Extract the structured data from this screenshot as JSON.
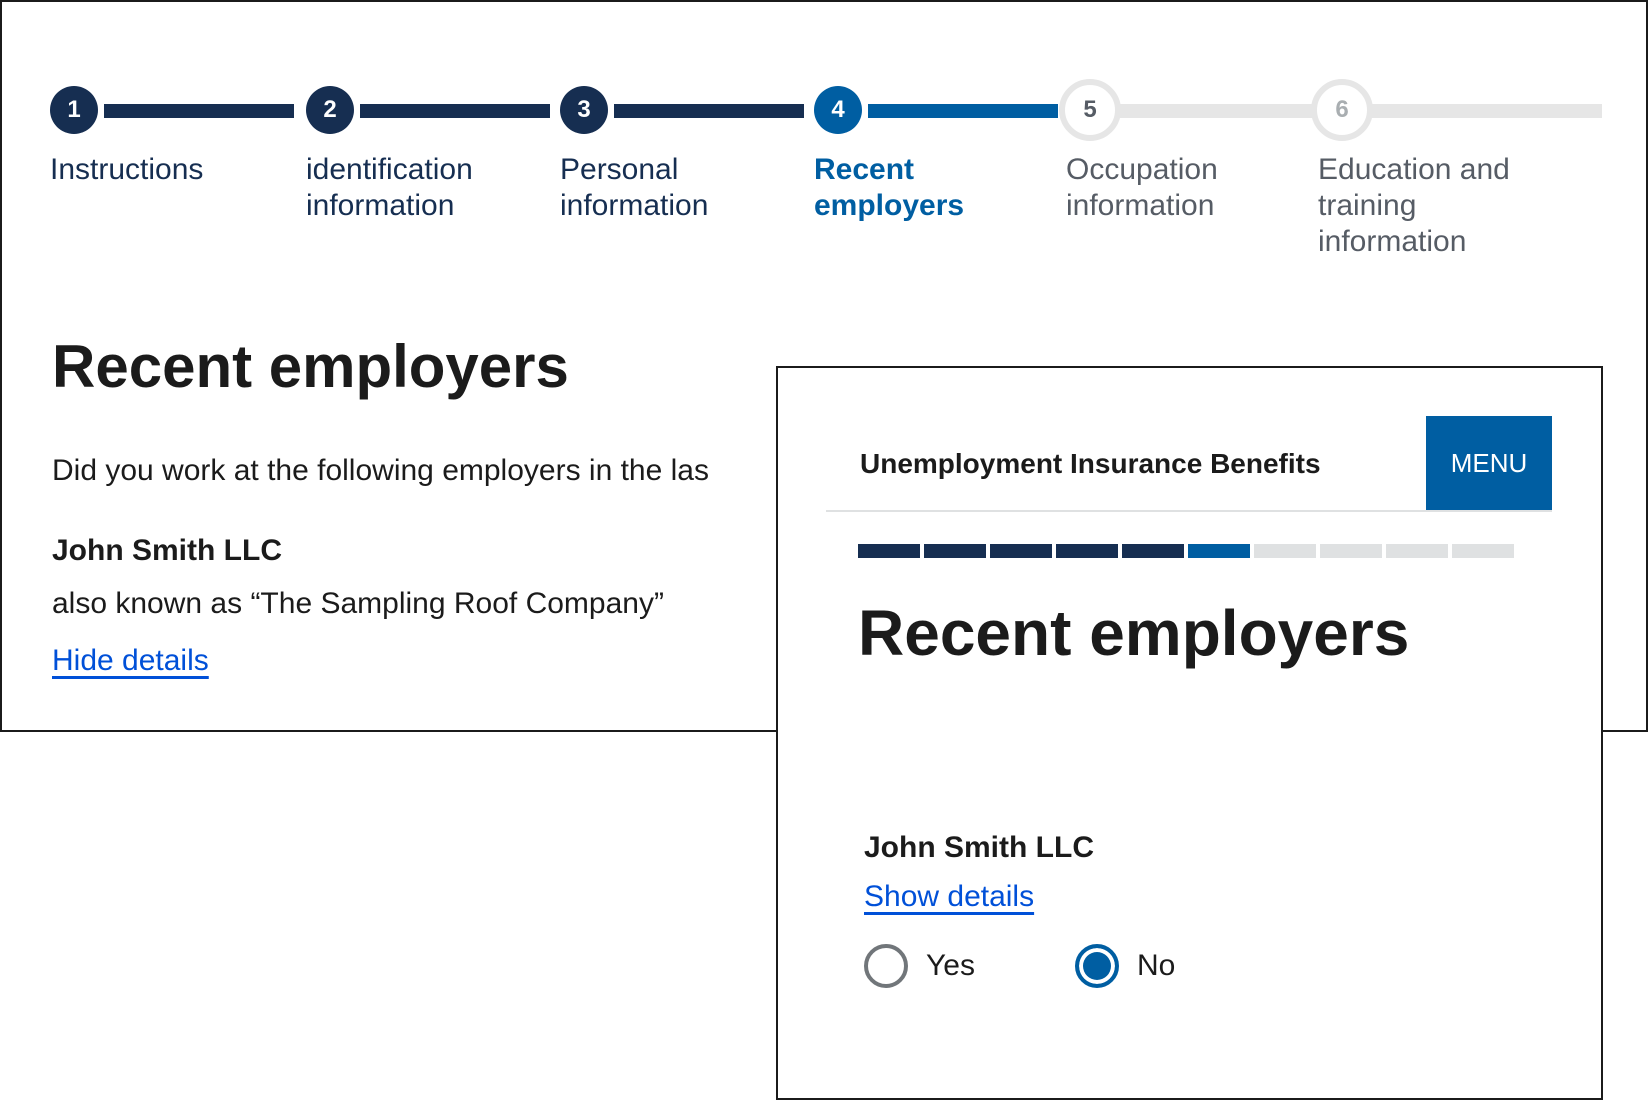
{
  "stepper": {
    "steps": [
      {
        "number": "1",
        "label": "Instructions",
        "state": "done"
      },
      {
        "number": "2",
        "label": "identification information",
        "state": "done"
      },
      {
        "number": "3",
        "label": "Personal information",
        "state": "done"
      },
      {
        "number": "4",
        "label": "Recent employers",
        "state": "current"
      },
      {
        "number": "5",
        "label": "Occupation information",
        "state": "todo"
      },
      {
        "number": "6",
        "label": "Education and training information",
        "state": "todo"
      }
    ]
  },
  "desktop": {
    "title": "Recent employers",
    "question": "Did you work at the following employers in the las",
    "employer_name": "John Smith LLC",
    "employer_aka": "also known as “The Sampling Roof Company”",
    "toggle_link": "Hide details"
  },
  "mobile": {
    "header_title": "Unemployment Insurance Benefits",
    "menu_label": "MENU",
    "progress": {
      "completed": 5,
      "current": 6,
      "total": 10
    },
    "title": "Recent employers",
    "employer_name": "John Smith LLC",
    "toggle_link": "Show details",
    "radio_options": [
      {
        "label": "Yes",
        "checked": false
      },
      {
        "label": "No",
        "checked": true
      }
    ]
  },
  "colors": {
    "primary_dark": "#162e51",
    "primary": "#005ea2",
    "link": "#0050d8",
    "inactive": "#e6e6e6"
  }
}
